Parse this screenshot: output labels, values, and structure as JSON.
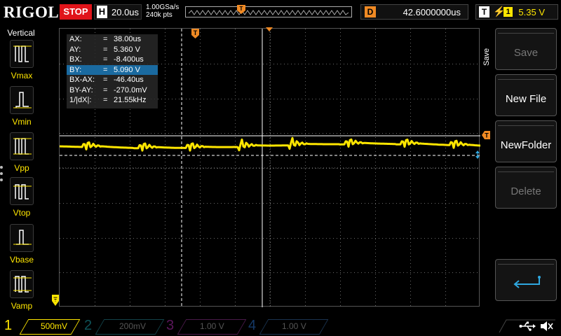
{
  "topbar": {
    "logo": "RIGOL",
    "run_state": "STOP",
    "horiz_label": "H",
    "timebase": "20.0us",
    "sample_rate": "1.00GSa/s",
    "memory_depth": "240k pts",
    "delay_label": "D",
    "delay_value": "42.6000000us",
    "trigger_label": "T",
    "trigger_source": "1",
    "trigger_level": "5.35 V"
  },
  "left_panel": {
    "title": "Vertical",
    "items": [
      {
        "label": "Vmax",
        "icon": "vmax-waveform-icon"
      },
      {
        "label": "Vmin",
        "icon": "vmin-waveform-icon"
      },
      {
        "label": "Vpp",
        "icon": "vpp-waveform-icon"
      },
      {
        "label": "Vtop",
        "icon": "vtop-waveform-icon"
      },
      {
        "label": "Vbase",
        "icon": "vbase-waveform-icon"
      },
      {
        "label": "Vamp",
        "icon": "vamp-waveform-icon"
      }
    ]
  },
  "cursor_readout": [
    {
      "key": "AX:",
      "eq": "=",
      "value": "38.00us",
      "selected": false
    },
    {
      "key": "AY:",
      "eq": "=",
      "value": "5.360 V",
      "selected": false
    },
    {
      "key": "BX:",
      "eq": "=",
      "value": "-8.400us",
      "selected": false
    },
    {
      "key": "BY:",
      "eq": "=",
      "value": "5.090 V",
      "selected": true
    },
    {
      "key": "BX-AX:",
      "eq": "=",
      "value": "-46.40us",
      "selected": false
    },
    {
      "key": "BY-AY:",
      "eq": "=",
      "value": "-270.0mV",
      "selected": false
    },
    {
      "key": "1/|dX|:",
      "eq": "=",
      "value": "21.55kHz",
      "selected": false
    }
  ],
  "right_panel": {
    "menu_title": "Save",
    "buttons": [
      {
        "label": "Save",
        "enabled": false
      },
      {
        "label": "New File",
        "enabled": true
      },
      {
        "label": "NewFolder",
        "enabled": true
      },
      {
        "label": "Delete",
        "enabled": false
      },
      {
        "label": "",
        "icon": "enter-return-icon",
        "enabled": true
      }
    ]
  },
  "channels": [
    {
      "number": "1",
      "scale": "500mV",
      "color": "#ffe600",
      "active": true
    },
    {
      "number": "2",
      "scale": "200mV",
      "color": "#1fb6c4",
      "active": false
    },
    {
      "number": "3",
      "scale": "1.00 V",
      "color": "#c832c8",
      "active": false
    },
    {
      "number": "4",
      "scale": "1.00 V",
      "color": "#2d7de0",
      "active": false
    }
  ],
  "colors": {
    "ch1": "#ffe600",
    "stop": "#e0141a",
    "marker_orange": "#f08a24",
    "selected_row": "#1a6aa0",
    "cursor_b_blue": "#2fa8e0"
  },
  "status_icons": [
    "usb-icon",
    "speaker-muted-icon"
  ]
}
